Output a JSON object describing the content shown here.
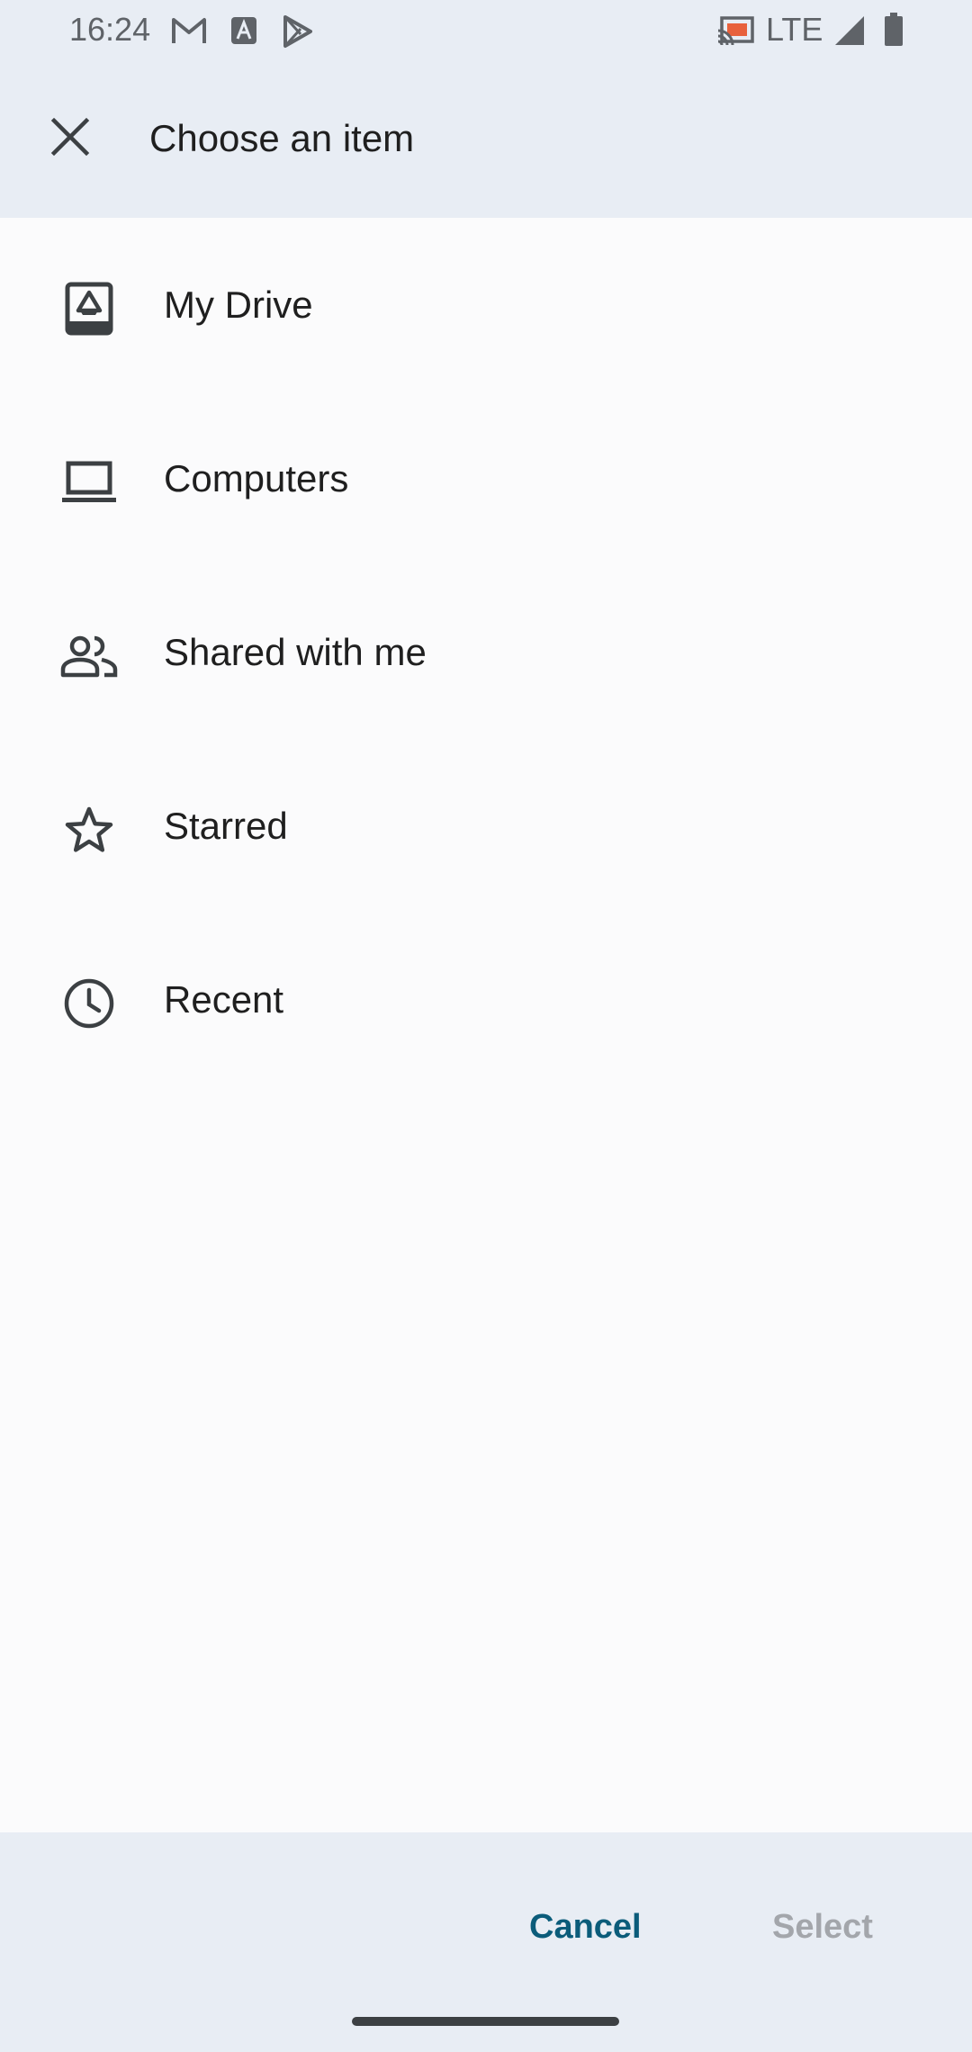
{
  "status_bar": {
    "time": "16:24",
    "network": "LTE",
    "icons": [
      "gmail-icon",
      "accessibility-a-icon",
      "play-icon",
      "cast-icon",
      "signal-icon",
      "battery-icon"
    ]
  },
  "header": {
    "title": "Choose an item",
    "close_icon": "close-icon"
  },
  "items": [
    {
      "label": "My Drive",
      "icon": "drive-icon"
    },
    {
      "label": "Computers",
      "icon": "laptop-icon"
    },
    {
      "label": "Shared with me",
      "icon": "people-icon"
    },
    {
      "label": "Starred",
      "icon": "star-icon"
    },
    {
      "label": "Recent",
      "icon": "clock-icon"
    }
  ],
  "footer": {
    "cancel_label": "Cancel",
    "select_label": "Select"
  },
  "colors": {
    "header_bg": "#e8edf4",
    "body_bg": "#fbfbfc",
    "accent": "#0b5c7a",
    "disabled": "#a3a6ab",
    "icon": "#3c4043"
  }
}
